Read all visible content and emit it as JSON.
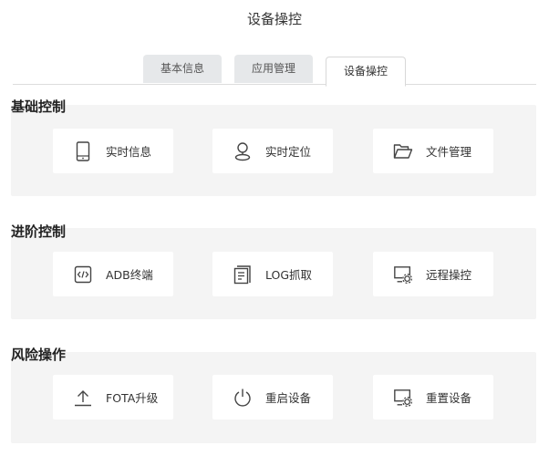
{
  "page": {
    "title": "设备操控"
  },
  "tabs": [
    {
      "label": "基本信息",
      "active": false
    },
    {
      "label": "应用管理",
      "active": false
    },
    {
      "label": "设备操控",
      "active": true
    }
  ],
  "sections": [
    {
      "title": "基础控制",
      "items": [
        {
          "label": "实时信息",
          "icon": "tablet-icon"
        },
        {
          "label": "实时定位",
          "icon": "location-pin-icon"
        },
        {
          "label": "文件管理",
          "icon": "folder-icon"
        }
      ]
    },
    {
      "title": "进阶控制",
      "items": [
        {
          "label": "ADB终端",
          "icon": "code-terminal-icon"
        },
        {
          "label": "LOG抓取",
          "icon": "log-document-icon"
        },
        {
          "label": "远程操控",
          "icon": "remote-control-icon"
        }
      ]
    },
    {
      "title": "风险操作",
      "items": [
        {
          "label": "FOTA升级",
          "icon": "upload-icon"
        },
        {
          "label": "重启设备",
          "icon": "power-icon"
        },
        {
          "label": "重置设备",
          "icon": "reset-device-icon"
        }
      ]
    }
  ]
}
